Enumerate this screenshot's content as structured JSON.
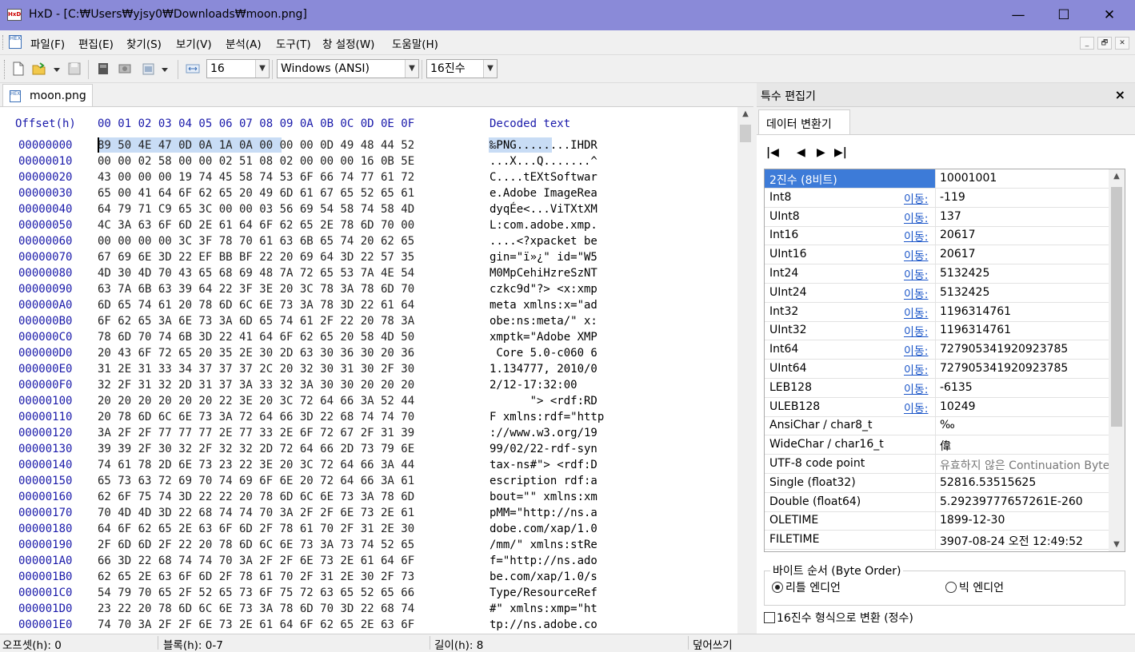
{
  "window": {
    "app_icon_text": "HxD",
    "title": "HxD - [C:₩Users₩yjsy0₩Downloads₩moon.png]",
    "minimize": "—",
    "maximize": "☐",
    "close": "✕"
  },
  "menu": [
    "파일(F)",
    "편집(E)",
    "찾기(S)",
    "보기(V)",
    "분석(A)",
    "도구(T)",
    "창 설정(W)",
    "도움말(H)"
  ],
  "mdi_buttons": [
    "_",
    "🗗",
    "✕"
  ],
  "toolbar": {
    "bytes_per_row": "16",
    "charset": "Windows (ANSI)",
    "offset_base": "16진수"
  },
  "file_tab": {
    "name": "moon.png"
  },
  "hex": {
    "header_offset": "Offset(h)",
    "header_columns": "00 01 02 03 04 05 06 07 08 09 0A 0B 0C 0D 0E 0F",
    "header_decoded": "Decoded text",
    "rows": [
      {
        "off": "00000000",
        "hex": "89 50 4E 47 0D 0A 1A 0A 00 00 00 0D 49 48 44 52",
        "txt": "‰PNG........IHDR"
      },
      {
        "off": "00000010",
        "hex": "00 00 02 58 00 00 02 51 08 02 00 00 00 16 0B 5E",
        "txt": "...X...Q.......^"
      },
      {
        "off": "00000020",
        "hex": "43 00 00 00 19 74 45 58 74 53 6F 66 74 77 61 72",
        "txt": "C....tEXtSoftwar"
      },
      {
        "off": "00000030",
        "hex": "65 00 41 64 6F 62 65 20 49 6D 61 67 65 52 65 61",
        "txt": "e.Adobe ImageRea"
      },
      {
        "off": "00000040",
        "hex": "64 79 71 C9 65 3C 00 00 03 56 69 54 58 74 58 4D",
        "txt": "dyqÉe<...ViTXtXM"
      },
      {
        "off": "00000050",
        "hex": "4C 3A 63 6F 6D 2E 61 64 6F 62 65 2E 78 6D 70 00",
        "txt": "L:com.adobe.xmp."
      },
      {
        "off": "00000060",
        "hex": "00 00 00 00 3C 3F 78 70 61 63 6B 65 74 20 62 65",
        "txt": "....<?xpacket be"
      },
      {
        "off": "00000070",
        "hex": "67 69 6E 3D 22 EF BB BF 22 20 69 64 3D 22 57 35",
        "txt": "gin=\"ï»¿\" id=\"W5"
      },
      {
        "off": "00000080",
        "hex": "4D 30 4D 70 43 65 68 69 48 7A 72 65 53 7A 4E 54",
        "txt": "M0MpCehiHzreSzNT"
      },
      {
        "off": "00000090",
        "hex": "63 7A 6B 63 39 64 22 3F 3E 20 3C 78 3A 78 6D 70",
        "txt": "czkc9d\"?> <x:xmp"
      },
      {
        "off": "000000A0",
        "hex": "6D 65 74 61 20 78 6D 6C 6E 73 3A 78 3D 22 61 64",
        "txt": "meta xmlns:x=\"ad"
      },
      {
        "off": "000000B0",
        "hex": "6F 62 65 3A 6E 73 3A 6D 65 74 61 2F 22 20 78 3A",
        "txt": "obe:ns:meta/\" x:"
      },
      {
        "off": "000000C0",
        "hex": "78 6D 70 74 6B 3D 22 41 64 6F 62 65 20 58 4D 50",
        "txt": "xmptk=\"Adobe XMP"
      },
      {
        "off": "000000D0",
        "hex": "20 43 6F 72 65 20 35 2E 30 2D 63 30 36 30 20 36",
        "txt": " Core 5.0-c060 6"
      },
      {
        "off": "000000E0",
        "hex": "31 2E 31 33 34 37 37 37 2C 20 32 30 31 30 2F 30",
        "txt": "1.134777, 2010/0"
      },
      {
        "off": "000000F0",
        "hex": "32 2F 31 32 2D 31 37 3A 33 32 3A 30 30 20 20 20",
        "txt": "2/12-17:32:00   "
      },
      {
        "off": "00000100",
        "hex": "20 20 20 20 20 20 22 3E 20 3C 72 64 66 3A 52 44",
        "txt": "      \"> <rdf:RD"
      },
      {
        "off": "00000110",
        "hex": "20 78 6D 6C 6E 73 3A 72 64 66 3D 22 68 74 74 70",
        "txt": "F xmlns:rdf=\"http"
      },
      {
        "off": "00000120",
        "hex": "3A 2F 2F 77 77 77 2E 77 33 2E 6F 72 67 2F 31 39",
        "txt": "://www.w3.org/19"
      },
      {
        "off": "00000130",
        "hex": "39 39 2F 30 32 2F 32 32 2D 72 64 66 2D 73 79 6E",
        "txt": "99/02/22-rdf-syn"
      },
      {
        "off": "00000140",
        "hex": "74 61 78 2D 6E 73 23 22 3E 20 3C 72 64 66 3A 44",
        "txt": "tax-ns#\"> <rdf:D"
      },
      {
        "off": "00000150",
        "hex": "65 73 63 72 69 70 74 69 6F 6E 20 72 64 66 3A 61",
        "txt": "escription rdf:a"
      },
      {
        "off": "00000160",
        "hex": "62 6F 75 74 3D 22 22 20 78 6D 6C 6E 73 3A 78 6D",
        "txt": "bout=\"\" xmlns:xm"
      },
      {
        "off": "00000170",
        "hex": "70 4D 4D 3D 22 68 74 74 70 3A 2F 2F 6E 73 2E 61",
        "txt": "pMM=\"http://ns.a"
      },
      {
        "off": "00000180",
        "hex": "64 6F 62 65 2E 63 6F 6D 2F 78 61 70 2F 31 2E 30",
        "txt": "dobe.com/xap/1.0"
      },
      {
        "off": "00000190",
        "hex": "2F 6D 6D 2F 22 20 78 6D 6C 6E 73 3A 73 74 52 65",
        "txt": "/mm/\" xmlns:stRe"
      },
      {
        "off": "000001A0",
        "hex": "66 3D 22 68 74 74 70 3A 2F 2F 6E 73 2E 61 64 6F",
        "txt": "f=\"http://ns.ado"
      },
      {
        "off": "000001B0",
        "hex": "62 65 2E 63 6F 6D 2F 78 61 70 2F 31 2E 30 2F 73",
        "txt": "be.com/xap/1.0/s"
      },
      {
        "off": "000001C0",
        "hex": "54 79 70 65 2F 52 65 73 6F 75 72 63 65 52 65 66",
        "txt": "Type/ResourceRef"
      },
      {
        "off": "000001D0",
        "hex": "23 22 20 78 6D 6C 6E 73 3A 78 6D 70 3D 22 68 74",
        "txt": "#\" xmlns:xmp=\"ht"
      },
      {
        "off": "000001E0",
        "hex": "74 70 3A 2F 2F 6E 73 2E 61 64 6F 62 65 2E 63 6F",
        "txt": "tp://ns.adobe.co"
      }
    ]
  },
  "inspector": {
    "title": "특수 편집기",
    "close": "×",
    "tab": "데이터 변환기",
    "nav": [
      "|◀",
      "◀",
      "▶",
      "▶|"
    ],
    "go_label": "이동:",
    "rows": [
      {
        "label": "2진수 (8비트)",
        "value": "10001001",
        "go": false
      },
      {
        "label": "Int8",
        "value": "-119",
        "go": true
      },
      {
        "label": "UInt8",
        "value": "137",
        "go": true
      },
      {
        "label": "Int16",
        "value": "20617",
        "go": true
      },
      {
        "label": "UInt16",
        "value": "20617",
        "go": true
      },
      {
        "label": "Int24",
        "value": "5132425",
        "go": true
      },
      {
        "label": "UInt24",
        "value": "5132425",
        "go": true
      },
      {
        "label": "Int32",
        "value": "1196314761",
        "go": true
      },
      {
        "label": "UInt32",
        "value": "1196314761",
        "go": true
      },
      {
        "label": "Int64",
        "value": "727905341920923785",
        "go": true
      },
      {
        "label": "UInt64",
        "value": "727905341920923785",
        "go": true
      },
      {
        "label": "LEB128",
        "value": "-6135",
        "go": true
      },
      {
        "label": "ULEB128",
        "value": "10249",
        "go": true
      },
      {
        "label": "AnsiChar / char8_t",
        "value": "‰",
        "go": false
      },
      {
        "label": "WideChar / char16_t",
        "value": "偉",
        "go": false
      },
      {
        "label": "UTF-8 code point",
        "value": "유효하지 않은 Continuation Byte",
        "go": false
      },
      {
        "label": "Single (float32)",
        "value": "52816.53515625",
        "go": false
      },
      {
        "label": "Double (float64)",
        "value": "5.29239777657261E-260",
        "go": false
      },
      {
        "label": "OLETIME",
        "value": "1899-12-30",
        "go": false
      },
      {
        "label": "FILETIME",
        "value": "3907-08-24 오전 12:49:52",
        "go": false
      }
    ],
    "byte_order_title": "바이트 순서 (Byte Order)",
    "little_endian": "리틀 엔디언",
    "big_endian": "빅 엔디언",
    "hex_checkbox": "16진수 형식으로 변환 (정수)"
  },
  "status": {
    "offset": "오프셋(h): 0",
    "block": "블록(h): 0-7",
    "length": "길이(h): 8",
    "mode": "덮어쓰기"
  }
}
